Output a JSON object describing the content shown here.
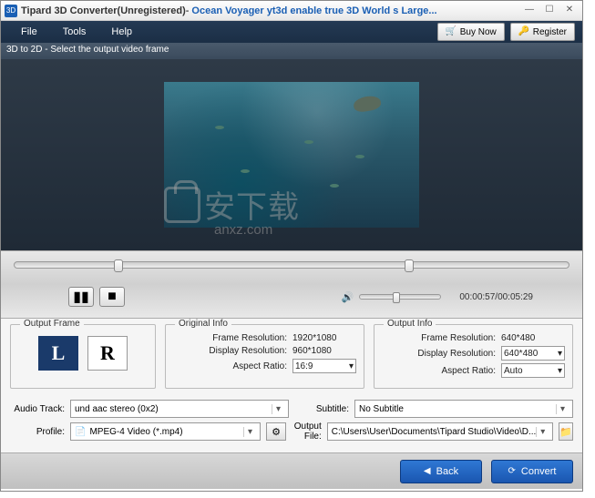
{
  "titlebar": {
    "icon_text": "3D",
    "app": "Tipard 3D Converter(Unregistered)",
    "separator": " - ",
    "file": "Ocean Voyager yt3d enable true 3D World s Large..."
  },
  "menu": {
    "file": "File",
    "tools": "Tools",
    "help": "Help",
    "buy": "Buy Now",
    "register": "Register"
  },
  "instruction": "3D to 2D - Select the output video frame",
  "playback": {
    "time": "00:00:57/00:05:29"
  },
  "output_frame": {
    "legend": "Output Frame",
    "left": "L",
    "right": "R"
  },
  "original_info": {
    "legend": "Original Info",
    "frame_res_label": "Frame Resolution:",
    "frame_res": "1920*1080",
    "disp_res_label": "Display Resolution:",
    "disp_res": "960*1080",
    "aspect_label": "Aspect Ratio:",
    "aspect": "16:9"
  },
  "output_info": {
    "legend": "Output Info",
    "frame_res_label": "Frame Resolution:",
    "frame_res": "640*480",
    "disp_res_label": "Display Resolution:",
    "disp_res": "640*480",
    "aspect_label": "Aspect Ratio:",
    "aspect": "Auto"
  },
  "form": {
    "audio_track_label": "Audio Track:",
    "audio_track": "und aac stereo (0x2)",
    "subtitle_label": "Subtitle:",
    "subtitle": "No Subtitle",
    "profile_label": "Profile:",
    "profile": "MPEG-4 Video (*.mp4)",
    "output_file_label": "Output File:",
    "output_file": "C:\\Users\\User\\Documents\\Tipard Studio\\Video\\D..."
  },
  "buttons": {
    "back": "Back",
    "convert": "Convert"
  },
  "watermark": {
    "main": "安下载",
    "sub": "anxz.com"
  }
}
